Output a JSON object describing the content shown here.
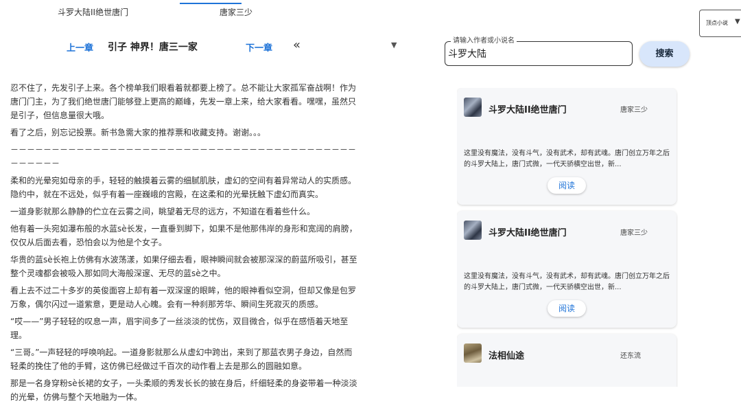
{
  "tabs": [
    {
      "label": "斗罗大陆II绝世唐门"
    },
    {
      "label": "唐家三少"
    }
  ],
  "chapter_nav": {
    "prev_label": "上一章",
    "title": "引子 神界！唐三一家",
    "next_label": "下一章",
    "collapse_icon": "«",
    "dropdown_icon": "▼"
  },
  "content": {
    "paragraphs": [
      "忍不住了，先发引子上来。各个榜单我们眼看着就都要上榜了。总不能让大家孤军奋战啊！作为唐门门主，为了我们绝世唐门能够登上更高的巅峰，先发一章上来，给大家看看。嘿嘿，虽然只是引子，但信息量很大哦。",
      "看了之后，别忘记投票。新书急需大家的推荐票和收藏支持。谢谢。。。",
      "－－－－－－－－－－－－－－－－－－－－－－－－－－－－－－－－－－－－－－－－－－－－－－－－",
      "柔和的光晕宛如母亲的手，轻轻的触摸着云雾的细腻肌肤，虚幻的空间有着异常动人的实质感。隐约中，就在不远处，似乎有着一座巍峨的宫殿，在这柔和的光晕抚触下虚幻而真实。",
      "一道身影就那么静静的伫立在云雾之间，眺望着无尽的远方，不知道在看着些什么。",
      "他有着一头宛如瀑布般的水蓝sè长发，一直垂到脚下，如果不是他那伟岸的身形和宽阔的肩膀，仅仅从后面去看，恐怕会以为他是个女子。",
      "华贵的蓝sè长袍上仿佛有水波荡漾，如果仔细去看，眼神瞬间就会被那深深的蔚蓝所吸引，甚至整个灵魂都会被吸入那如同大海般深邃、无尽的蓝sè之中。",
      "看上去不过二十多岁的英俊面容上却有着一双深邃的眼眸，他的眼神看似空洞，但却又像是包罗万象，偶尔闪过一道紫意，更是动人心魄。会有一种刹那芳华、瞬间生死寂灭的质感。",
      "“哎——”男子轻轻的叹息一声，眉宇间多了一丝淡淡的忧伤，双目微合，似乎在感悟着天地至理。",
      "“三哥。”一声轻轻的呼唤响起。一道身影就那么从虚幻中跨出，来到了那蓝衣男子身边，自然而轻柔的挽住了他的手臂，这仿佛已经做过千百次的动作看上去是那么的圆融如意。",
      "那是一名身穿粉sè长裙的女子，一头柔顺的秀发长长的披在身后，纤细轻柔的身姿带着一种淡淡的光晕，仿佛与整个天地融为一体。"
    ]
  },
  "sort_select": {
    "value": "顶点小说",
    "arrow_icon": "▼"
  },
  "search": {
    "label": "请输入作者或小说名",
    "value": "斗罗大陆",
    "button_label": "搜索"
  },
  "results": [
    {
      "title": "斗罗大陆II绝世唐门",
      "author": "唐家三少",
      "description": "这里没有魔法，没有斗气，没有武术，却有武魂。唐门创立万年之后的斗罗大陆上，唐门式微，一代天骄横空出世，新...",
      "read_label": "阅读",
      "cover_icon": "book-cover-icon"
    },
    {
      "title": "斗罗大陆II绝世唐门",
      "author": "唐家三少",
      "description": "这里没有魔法，没有斗气，没有武术，却有武魂。唐门创立万年之后的斗罗大陆上，唐门式微，一代天骄横空出世，新...",
      "read_label": "阅读",
      "cover_icon": "book-cover-icon"
    },
    {
      "title": "法相仙途",
      "author": "还东流",
      "description": "",
      "read_label": "",
      "cover_icon": "book-cover-icon"
    }
  ],
  "colors": {
    "accent": "#1e73d8",
    "search_button_bg": "#d8e6fb",
    "card_bg": "#f6f7f9"
  }
}
